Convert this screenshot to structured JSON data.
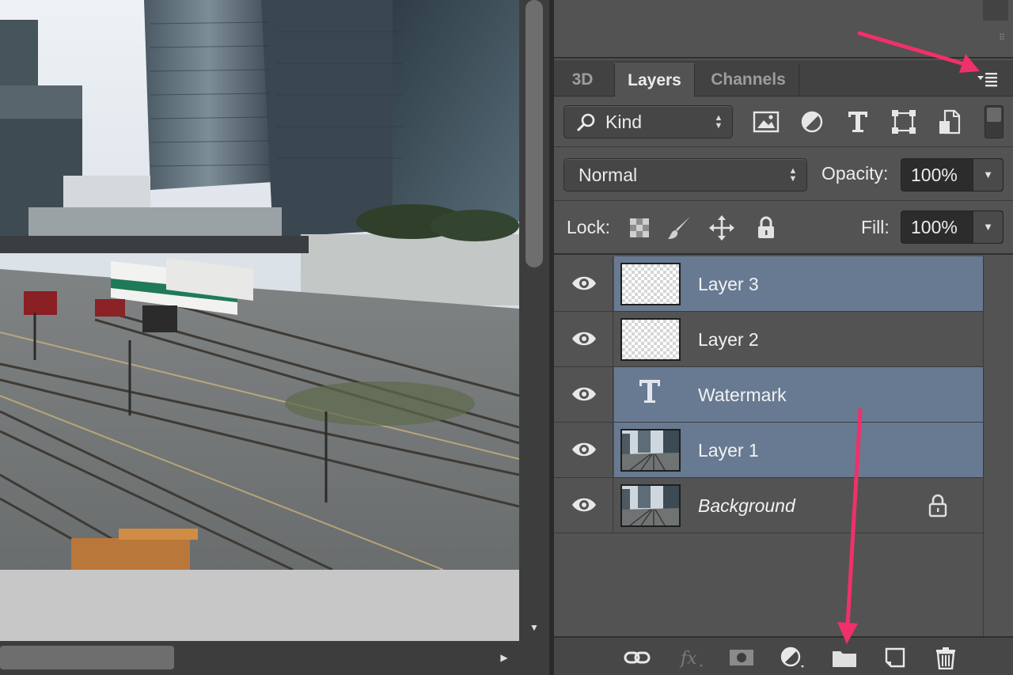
{
  "panel": {
    "tabs": [
      {
        "label": "3D",
        "active": false
      },
      {
        "label": "Layers",
        "active": true
      },
      {
        "label": "Channels",
        "active": false
      }
    ],
    "menu_icon": "panel-menu-icon"
  },
  "filter": {
    "kind_label": "Kind",
    "icons": [
      "pixel-layer-filter-icon",
      "adjustment-layer-filter-icon",
      "type-layer-filter-icon",
      "shape-layer-filter-icon",
      "smart-object-filter-icon"
    ]
  },
  "blend": {
    "mode": "Normal",
    "opacity_label": "Opacity:",
    "opacity_value": "100%"
  },
  "lock": {
    "label": "Lock:",
    "fill_label": "Fill:",
    "fill_value": "100%",
    "icons": [
      "lock-transparent-pixels-icon",
      "lock-image-pixels-icon",
      "lock-position-icon",
      "lock-all-icon"
    ]
  },
  "layers": [
    {
      "name": "Layer 3",
      "selected": true,
      "thumbnail": "transparent",
      "visible": true
    },
    {
      "name": "Layer 2",
      "selected": false,
      "thumbnail": "transparent",
      "visible": true
    },
    {
      "name": "Watermark",
      "selected": true,
      "thumbnail": "type",
      "visible": true
    },
    {
      "name": "Layer 1",
      "selected": true,
      "thumbnail": "photo",
      "visible": true
    },
    {
      "name": "Background",
      "selected": false,
      "thumbnail": "photo",
      "visible": true,
      "locked": true,
      "italic": true
    }
  ],
  "bottom_bar": {
    "icons": [
      "link-layers-icon",
      "fx-icon",
      "add-mask-icon",
      "adjustment-layer-icon",
      "new-group-icon",
      "new-layer-icon",
      "delete-layer-icon"
    ]
  },
  "colors": {
    "panel_bg": "#535353",
    "selection": "#687a92",
    "annotation_arrow": "#f0306a"
  }
}
